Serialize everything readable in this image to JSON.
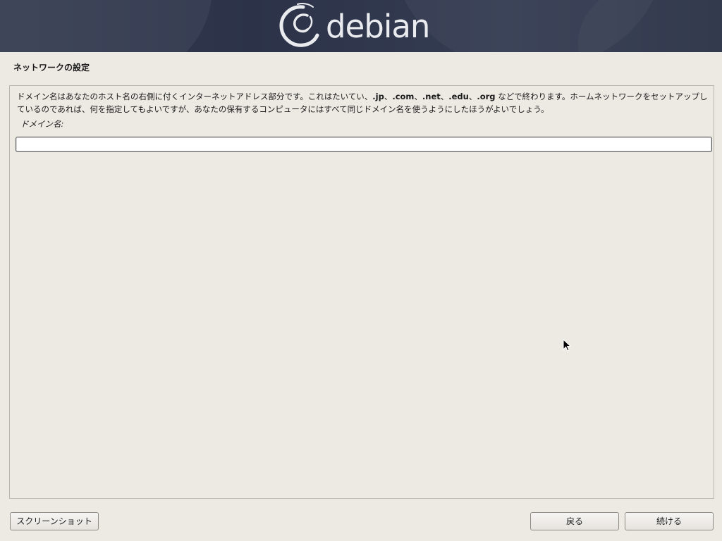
{
  "banner": {
    "logo_text": "debian"
  },
  "page": {
    "title": "ネットワークの設定"
  },
  "main": {
    "description_parts": [
      {
        "text": "ドメイン名はあなたのホスト名の右側に付くインターネットアドレス部分です。これはたいてい、",
        "bold": false
      },
      {
        "text": ".jp",
        "bold": true
      },
      {
        "text": "、",
        "bold": false
      },
      {
        "text": ".com",
        "bold": true
      },
      {
        "text": "、",
        "bold": false
      },
      {
        "text": ".net",
        "bold": true
      },
      {
        "text": "、",
        "bold": false
      },
      {
        "text": ".edu",
        "bold": true
      },
      {
        "text": "、",
        "bold": false
      },
      {
        "text": ".org",
        "bold": true
      },
      {
        "text": " などで終わります。ホームネットワークをセットアップしているのであれば、何を指定してもよいですが、あなたの保有するコンピュータにはすべて同じドメイン名を使うようにしたほうがよいでしょう。",
        "bold": false
      }
    ],
    "field_label": "ドメイン名:",
    "field_value": ""
  },
  "buttons": {
    "screenshot": "スクリーンショット",
    "back": "戻る",
    "continue": "続ける"
  },
  "colors": {
    "banner_bg": "#2f364c",
    "window_bg": "#edeae4",
    "logo_swirl": "#d70751"
  }
}
